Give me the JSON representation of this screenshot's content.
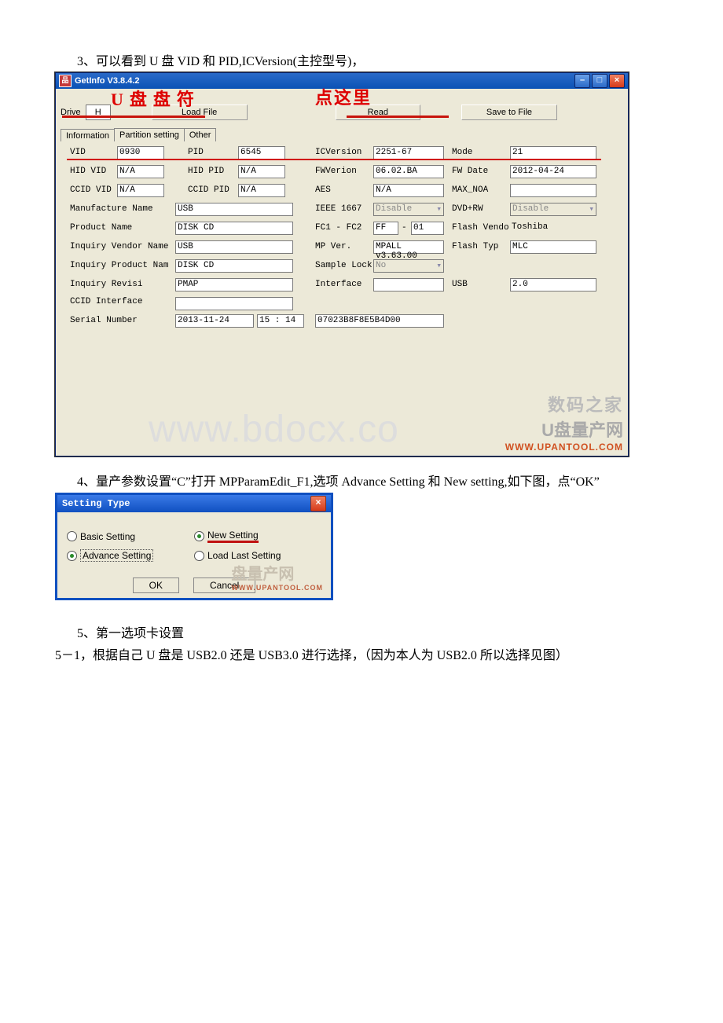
{
  "doc": {
    "p3": "3、可以看到 U 盘 VID 和 PID,ICVersion(主控型号)，",
    "p4": "4、量产参数设置“C”打开 MPParamEdit_F1,选项 Advance Setting 和 New setting,如下图，点“OK”",
    "p5": "5、第一选项卡设置",
    "p5_1": "5－1，根据自己 U 盘是 USB2.0 还是 USB3.0 进行选择，（因为本人为 USB2.0 所以选择见图）"
  },
  "win1": {
    "title": "GetInfo V3.8.4.2",
    "overlay_upan": "U盘盘符",
    "overlay_click": "点这里",
    "drive_label": "Drive",
    "drive_value": "H",
    "btn_loadfile": "Load File",
    "btn_read": "Read",
    "btn_save": "Save to File",
    "tabs": {
      "info": "Information",
      "part": "Partition setting",
      "other": "Other"
    },
    "labels": {
      "vid": "VID",
      "pid": "PID",
      "icv": "ICVersion",
      "mode": "Mode",
      "hidvid": "HID VID",
      "hidpid": "HID PID",
      "fwv": "FWVerion",
      "fwd": "FW Date",
      "ccidvid": "CCID VID",
      "ccidpid": "CCID PID",
      "aes": "AES",
      "maxnoa": "MAX_NOA",
      "mfg": "Manufacture Name",
      "ieee": "IEEE 1667",
      "dvdrw": "DVD+RW",
      "prod": "Product Name",
      "fc": "FC1 - FC2",
      "fvend": "Flash Vendo",
      "ivn": "Inquiry Vendor Name",
      "mpv": "MP Ver.",
      "ftyp": "Flash Typ",
      "ipn": "Inquiry Product Nam",
      "slock": "Sample Lock",
      "irev": "Inquiry Revisi",
      "iface": "Interface",
      "usb": "USB",
      "ccidif": "CCID Interface",
      "serial": "Serial Number"
    },
    "values": {
      "vid": "0930",
      "pid": "6545",
      "icv": "2251-67",
      "mode": "21",
      "hidvid": "N/A",
      "hidpid": "N/A",
      "fwv": "06.02.BA",
      "fwd": "2012-04-24",
      "ccidvid": "N/A",
      "ccidpid": "N/A",
      "aes": "N/A",
      "maxnoa": "",
      "mfg": "USB",
      "ieee": "Disable",
      "dvdrw": "Disable",
      "prod": "DISK CD",
      "fc1": "FF",
      "fc2": "01",
      "fvend": "Toshiba",
      "ivn": "USB",
      "mpv": "MPALL v3.63.00",
      "ftyp": "MLC",
      "ipn": "DISK CD",
      "slock": "No",
      "irev": "PMAP",
      "usb": "2.0",
      "serial_date": "2013-11-24",
      "serial_time": "15 : 14",
      "serial2": "07023B8F8E5B4D00"
    },
    "wm1": "www.bdocx.co",
    "wm2a": "数码之家",
    "wm2b": "U盘量产网",
    "wm2c": "WWW.UPANTOOL.COM"
  },
  "dlg": {
    "title": "Setting Type",
    "basic": "Basic Setting",
    "advance": "Advance Setting",
    "newset": "New Setting",
    "loadlast": "Load Last Setting",
    "ok": "OK",
    "cancel": "Cancel",
    "wm": "盘量产网",
    "wmurl": "WWW.UPANTOOL.COM"
  }
}
